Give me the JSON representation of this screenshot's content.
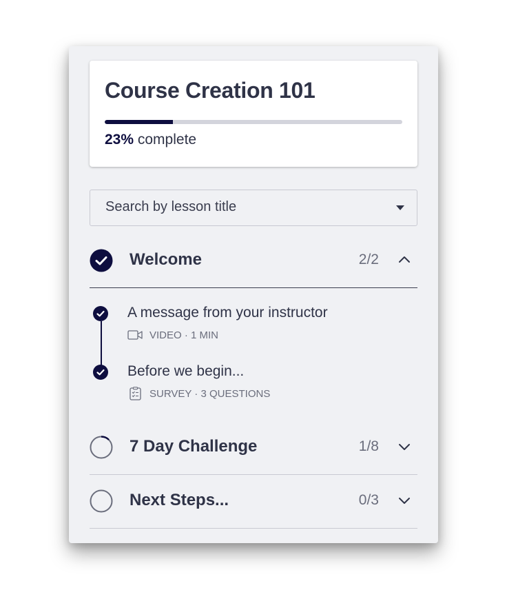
{
  "course": {
    "title": "Course Creation 101",
    "progress_value": 23,
    "progress_percent_label": "23%",
    "progress_suffix": "complete"
  },
  "search": {
    "placeholder": "Search by lesson title"
  },
  "sections": [
    {
      "title": "Welcome",
      "count": "2/2",
      "state": "complete",
      "expanded": true,
      "lessons": [
        {
          "title": "A message from your instructor",
          "meta": "VIDEO · 1 MIN",
          "icon": "video-icon",
          "completed": true
        },
        {
          "title": "Before we begin...",
          "meta": "SURVEY · 3 QUESTIONS",
          "icon": "survey-icon",
          "completed": true
        }
      ]
    },
    {
      "title": "7 Day Challenge",
      "count": "1/8",
      "state": "in-progress",
      "progress_fraction": 0.125,
      "expanded": false
    },
    {
      "title": "Next Steps...",
      "count": "0/3",
      "state": "not-started",
      "progress_fraction": 0,
      "expanded": false
    }
  ],
  "colors": {
    "accent": "#0e0e3f",
    "text": "#2f3347",
    "muted": "#6a6d7c",
    "panel_bg": "#f0f1f4",
    "track": "#d3d4dc"
  }
}
